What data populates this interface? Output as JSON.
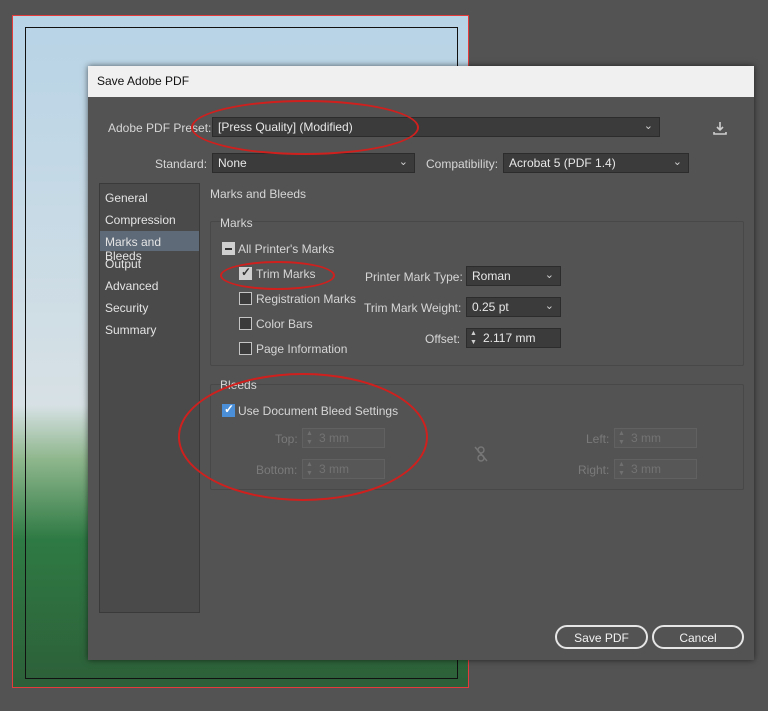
{
  "dialog": {
    "title": "Save Adobe PDF"
  },
  "preset": {
    "label": "Adobe PDF Preset:",
    "value": "[Press Quality] (Modified)",
    "save_icon": "download-icon"
  },
  "standard": {
    "label": "Standard:",
    "value": "None"
  },
  "compatibility": {
    "label": "Compatibility:",
    "value": "Acrobat 5 (PDF 1.4)"
  },
  "sidebar": {
    "items": [
      {
        "label": "General"
      },
      {
        "label": "Compression"
      },
      {
        "label": "Marks and Bleeds",
        "selected": true
      },
      {
        "label": "Output"
      },
      {
        "label": "Advanced"
      },
      {
        "label": "Security"
      },
      {
        "label": "Summary"
      }
    ]
  },
  "section": {
    "title": "Marks and Bleeds"
  },
  "marks": {
    "title": "Marks",
    "all_printers_marks": {
      "label": "All Printer's Marks",
      "state": "mixed"
    },
    "trim_marks": {
      "label": "Trim Marks",
      "checked": true
    },
    "registration_marks": {
      "label": "Registration Marks",
      "checked": false
    },
    "color_bars": {
      "label": "Color Bars",
      "checked": false
    },
    "page_information": {
      "label": "Page Information",
      "checked": false
    },
    "printer_mark_type": {
      "label": "Printer Mark Type:",
      "value": "Roman"
    },
    "trim_mark_weight": {
      "label": "Trim Mark Weight:",
      "value": "0.25 pt"
    },
    "offset": {
      "label": "Offset:",
      "value": "2.117 mm"
    }
  },
  "bleeds": {
    "title": "Bleeds",
    "use_document": {
      "label": "Use Document Bleed Settings",
      "checked": true
    },
    "top": {
      "label": "Top:",
      "value": "3 mm"
    },
    "bottom": {
      "label": "Bottom:",
      "value": "3 mm"
    },
    "left": {
      "label": "Left:",
      "value": "3 mm"
    },
    "right": {
      "label": "Right:",
      "value": "3 mm"
    },
    "link_icon": "unlink-icon"
  },
  "buttons": {
    "save": "Save PDF",
    "cancel": "Cancel"
  },
  "colors": {
    "annotation_ellipse": "#d0201e",
    "selected_item": "#5f6a78",
    "checkbox_blue": "#4a8fd8"
  }
}
